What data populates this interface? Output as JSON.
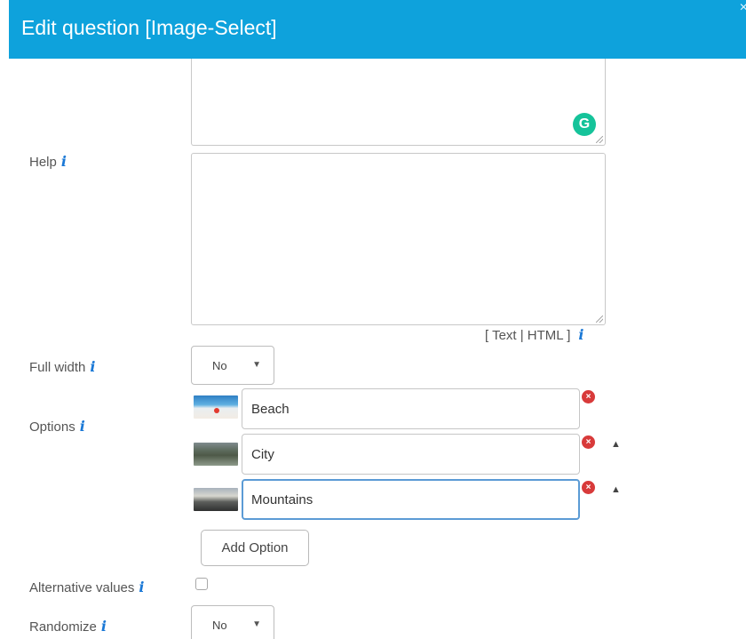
{
  "dialog": {
    "title": "Edit question [Image-Select]",
    "close": "×"
  },
  "fields": {
    "help_label": "Help",
    "info_glyph": "i",
    "format_links": "[ Text | HTML ]",
    "full_width_label": "Full width",
    "full_width_value": "No",
    "options_label": "Options",
    "alternative_values_label": "Alternative values",
    "randomize_label": "Randomize",
    "randomize_value": "No"
  },
  "options": [
    {
      "label": "Beach",
      "thumb_icon": "beach-thumbnail"
    },
    {
      "label": "City",
      "thumb_icon": "city-thumbnail"
    },
    {
      "label": "Mountains",
      "thumb_icon": "mountains-thumbnail"
    }
  ],
  "buttons": {
    "add_option": "Add Option"
  },
  "icons": {
    "remove": "×",
    "move_up": "▲",
    "caret": "▼",
    "grammarly": "G"
  },
  "colors": {
    "header": "#0ea2dc",
    "info": "#1a78d6",
    "remove": "#d83a3a",
    "focus": "#5b9bd5",
    "grammarly": "#15c39a"
  }
}
